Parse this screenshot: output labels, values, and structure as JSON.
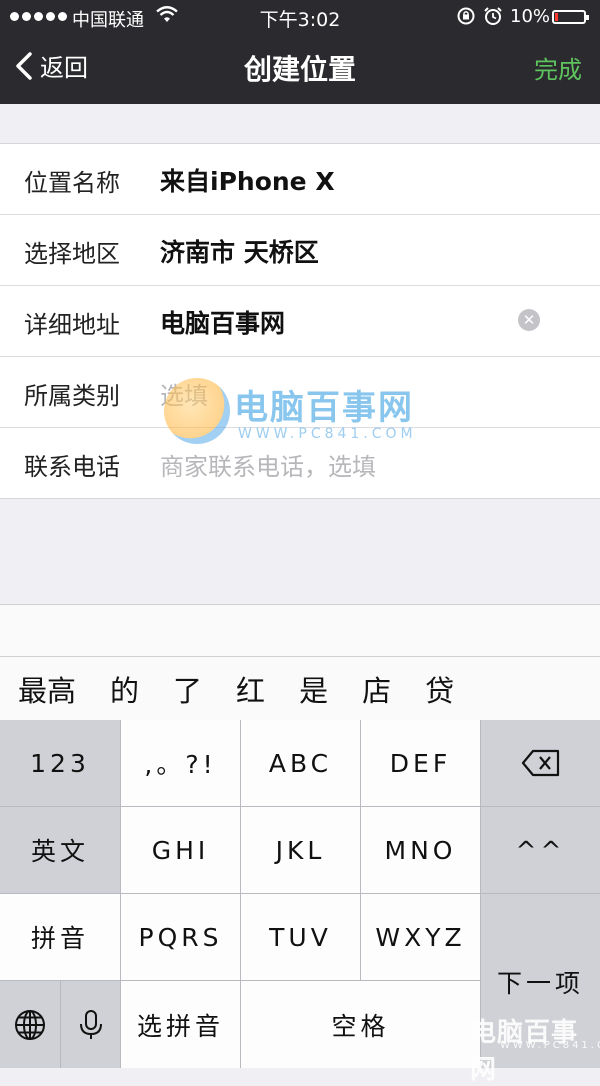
{
  "status": {
    "carrier": "中国联通",
    "time": "下午3:02",
    "battery": "10%"
  },
  "nav": {
    "back": "返回",
    "title": "创建位置",
    "done": "完成"
  },
  "form": {
    "name_label": "位置名称",
    "name_value": "来自iPhone X",
    "region_label": "选择地区",
    "region_value": "济南市 天桥区",
    "address_label": "详细地址",
    "address_value": "电脑百事网",
    "category_label": "所属类别",
    "category_placeholder": "选填",
    "phone_label": "联系电话",
    "phone_placeholder": "商家联系电话，选填"
  },
  "watermark": {
    "text": "电脑百事网",
    "url": "WWW.PC841.COM"
  },
  "candidates": [
    "最高",
    "的",
    "了",
    "红",
    "是",
    "店",
    "贷"
  ],
  "keyboard": {
    "k123": "123",
    "punct": ",。?!",
    "abc": "ABC",
    "def": "DEF",
    "english": "英文",
    "ghi": "GHI",
    "jkl": "JKL",
    "mno": "MNO",
    "emoticon": "^^",
    "pinyin": "拼音",
    "pqrs": "PQRS",
    "tuv": "TUV",
    "wxyz": "WXYZ",
    "next": "下一项",
    "select_pinyin": "选拼音",
    "space": "空格"
  },
  "colors": {
    "navbar": "#2b2b2f",
    "done_green": "#5ec55e"
  }
}
